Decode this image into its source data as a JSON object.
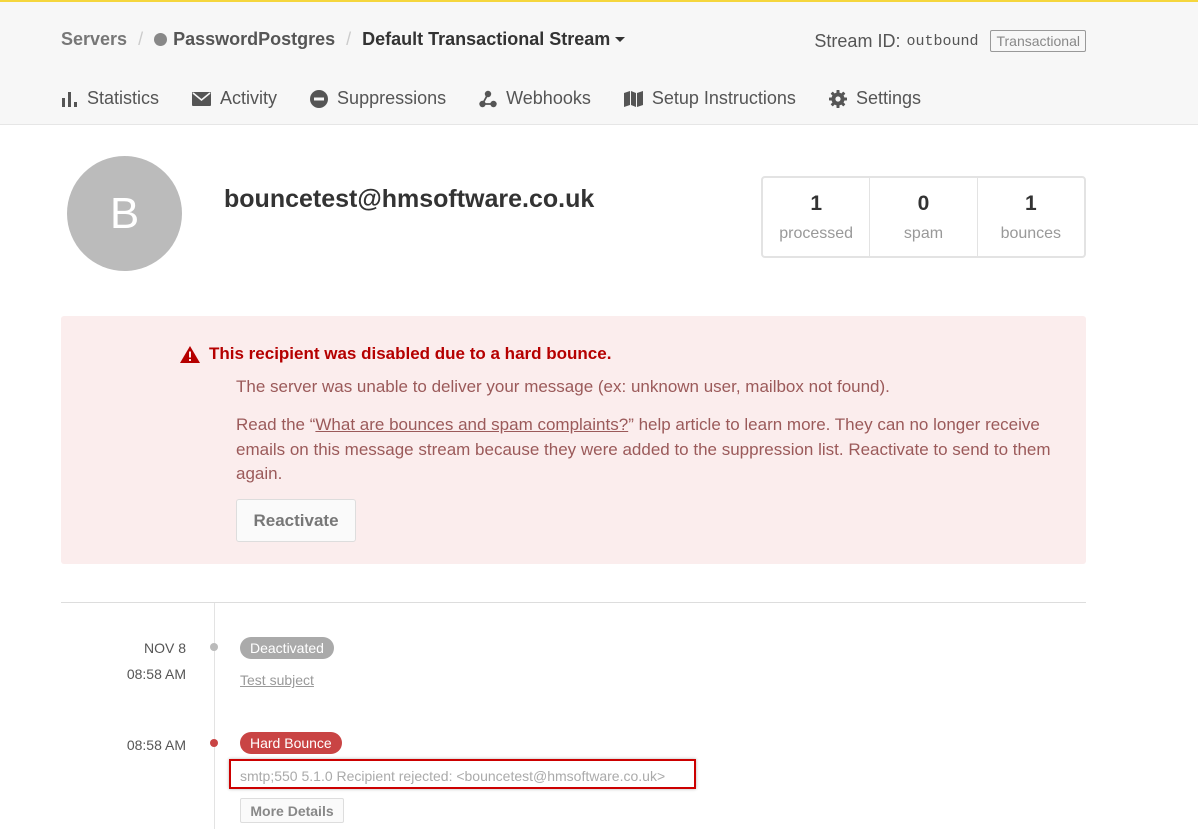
{
  "breadcrumb": {
    "servers": "Servers",
    "server_name": "PasswordPostgres",
    "stream_name": "Default Transactional Stream"
  },
  "stream": {
    "id_label": "Stream ID:",
    "id_value": "outbound",
    "type_tag": "Transactional"
  },
  "nav": [
    {
      "label": "Statistics",
      "icon": "bar-chart-icon"
    },
    {
      "label": "Activity",
      "icon": "envelope-icon"
    },
    {
      "label": "Suppressions",
      "icon": "minus-circle-icon"
    },
    {
      "label": "Webhooks",
      "icon": "webhook-icon"
    },
    {
      "label": "Setup Instructions",
      "icon": "map-icon"
    },
    {
      "label": "Settings",
      "icon": "gear-icon"
    }
  ],
  "recipient": {
    "avatar_letter": "B",
    "email": "bouncetest@hmsoftware.co.uk"
  },
  "stats": [
    {
      "value": "1",
      "label": "processed"
    },
    {
      "value": "0",
      "label": "spam"
    },
    {
      "value": "1",
      "label": "bounces"
    }
  ],
  "alert": {
    "title": "This recipient was disabled due to a hard bounce.",
    "line1": "The server was unable to deliver your message (ex: unknown user, mailbox not found).",
    "line2_pre": "Read the “",
    "line2_link": "What are bounces and spam complaints?",
    "line2_post": "” help article to learn more. They can no longer receive emails on this message stream because they were added to the suppression list. Reactivate to send to them again.",
    "button": "Reactivate"
  },
  "timeline": [
    {
      "date": "NOV 8",
      "time": "08:58 AM",
      "badge": "Deactivated",
      "subject": "Test subject"
    },
    {
      "time": "08:58 AM",
      "badge": "Hard Bounce",
      "detail": "smtp;550 5.1.0 Recipient rejected: <bouncetest@hmsoftware.co.uk>",
      "button": "More Details"
    }
  ],
  "colors": {
    "accent_top": "#f5d63d",
    "alert_bg": "#fbeded",
    "alert_title": "#b50000",
    "hard_bounce": "#c94444",
    "deactivated": "#aaaaaa"
  }
}
